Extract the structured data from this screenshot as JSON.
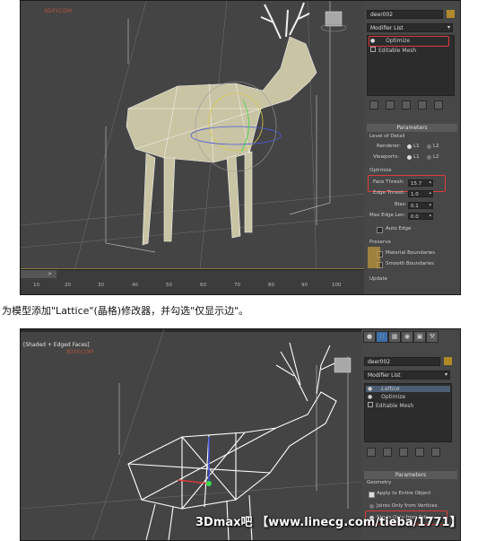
{
  "screenshot1": {
    "watermark": "3DXY.COM",
    "object_name": "deer002",
    "modifier_list_label": "Modifier List",
    "stack": [
      "Optimize",
      "Editable Mesh"
    ],
    "parameters_title": "Parameters",
    "level_of_detail": "Level of Detail",
    "renderer_label": "Renderer:",
    "viewports_label": "Viewports:",
    "l1": "L1",
    "l2": "L2",
    "optimize_group": "Optimize",
    "face_thresh_label": "Face Thresh:",
    "face_thresh_value": "15.7",
    "edge_thresh_label": "Edge Thresh:",
    "edge_thresh_value": "1.0",
    "bias_label": "Bias:",
    "bias_value": "0.1",
    "max_edge_len_label": "Max Edge Len:",
    "max_edge_len_value": "0.0",
    "auto_edge_label": "Auto Edge",
    "preserve_group": "Preserve",
    "material_boundaries": "Material Boundaries",
    "smooth_boundaries": "Smooth Boundaries",
    "update_group": "Update",
    "ruler_ticks": [
      "10",
      "20",
      "30",
      "40",
      "50",
      "60",
      "70",
      "80",
      "90",
      "100"
    ]
  },
  "caption": "为模型添加\"Lattice\"(晶格)修改器，并勾选\"仅显示边\"。",
  "screenshot2": {
    "viewport_label": "[Shaded + Edged Faces]",
    "watermark": "3DXY.COM",
    "object_name": "deer002",
    "modifier_list_label": "Modifier List",
    "stack": [
      "Lattice",
      "Optimize",
      "Editable Mesh"
    ],
    "parameters_title": "Parameters",
    "geometry_group": "Geometry",
    "apply_entire_label": "Apply to Entire Object",
    "joints_only_label": "Joints Only from Vertices",
    "struts_only_label": "Struts Only from Edges"
  },
  "bottom_watermark": "3Dmax吧 【www.linecg.com/tieba/1771】"
}
